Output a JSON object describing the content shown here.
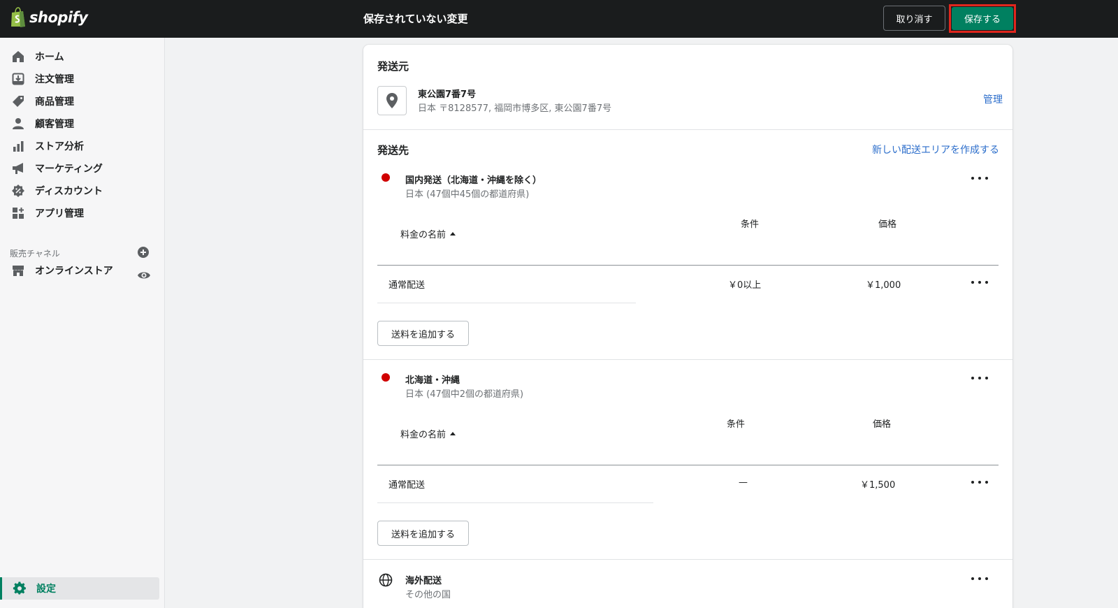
{
  "brand": {
    "name": "shopify"
  },
  "topbar": {
    "title": "保存されていない変更",
    "discard_label": "取り消す",
    "save_label": "保存する"
  },
  "sidebar": {
    "items": [
      {
        "label": "ホーム",
        "icon": "home-icon"
      },
      {
        "label": "注文管理",
        "icon": "orders-icon"
      },
      {
        "label": "商品管理",
        "icon": "tag-icon"
      },
      {
        "label": "顧客管理",
        "icon": "customer-icon"
      },
      {
        "label": "ストア分析",
        "icon": "analytics-icon"
      },
      {
        "label": "マーケティング",
        "icon": "megaphone-icon"
      },
      {
        "label": "ディスカウント",
        "icon": "discount-icon"
      },
      {
        "label": "アプリ管理",
        "icon": "apps-icon"
      }
    ],
    "channels_label": "販売チャネル",
    "online_store_label": "オンラインストア",
    "settings_label": "設定"
  },
  "shipping_origin": {
    "heading": "発送元",
    "location_name": "東公園7番7号",
    "address": "日本 〒8128577, 福岡市博多区, 東公園7番7号",
    "manage_link": "管理"
  },
  "shipping_to": {
    "heading": "発送先",
    "create_zone_link": "新しい配送エリアを作成する",
    "zones": [
      {
        "name": "国内発送（北海道・沖縄を除く）",
        "subtitle": "日本 (47個中45個の都道府県)",
        "col_name": "料金の名前",
        "col_condition": "条件",
        "col_price": "価格",
        "rate_name": "通常配送",
        "rate_condition": "￥0以上",
        "rate_price": "￥1,000",
        "add_rate_label": "送料を追加する"
      },
      {
        "name": "北海道・沖縄",
        "subtitle": "日本 (47個中2個の都道府県)",
        "col_name": "料金の名前",
        "col_condition": "条件",
        "col_price": "価格",
        "rate_name": "通常配送",
        "rate_condition": "—",
        "rate_price": "￥1,500",
        "add_rate_label": "送料を追加する"
      },
      {
        "name": "海外配送",
        "subtitle": "その他の国"
      }
    ]
  },
  "colors": {
    "accent": "#008060",
    "highlight": "#e0261d",
    "zone_dot": "#d00000",
    "link": "#2c6ecb"
  }
}
